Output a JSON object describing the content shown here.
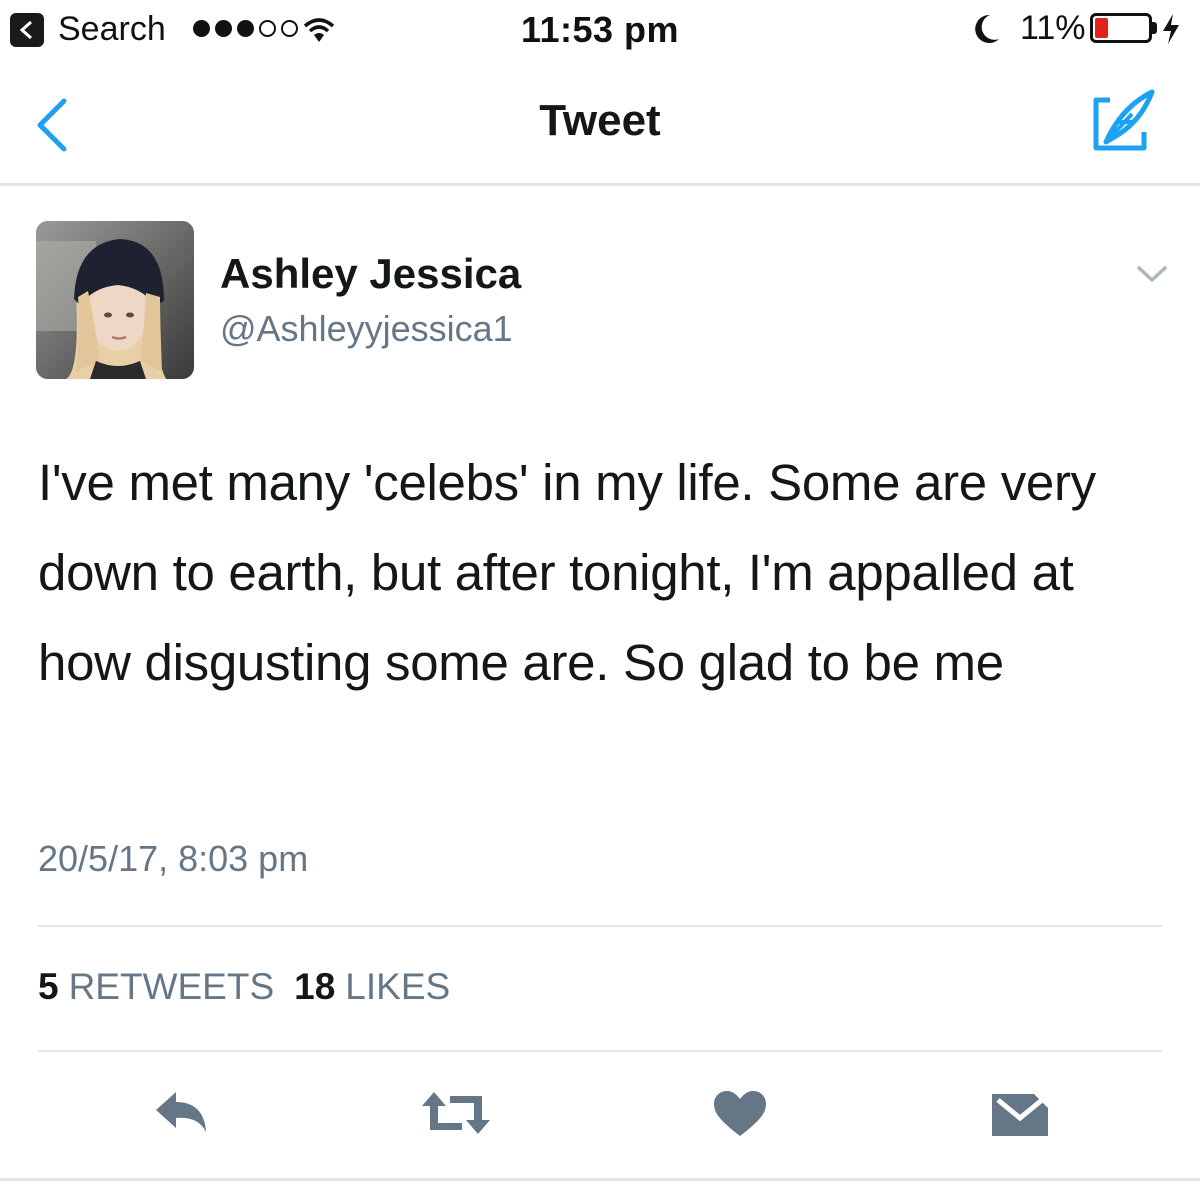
{
  "status_bar": {
    "back_app_label": "Search",
    "time": "11:53 pm",
    "battery_percent": "11%",
    "battery_level": 0.11,
    "signal_bars_filled": 3,
    "signal_bars_total": 5,
    "icons": [
      "back-triangle-icon",
      "signal-dots-icon",
      "wifi-icon",
      "moon-icon",
      "battery-icon",
      "charging-bolt-icon"
    ]
  },
  "nav": {
    "title": "Tweet",
    "icons": [
      "chevron-left-icon",
      "compose-quill-icon"
    ],
    "accent_color": "#1da1f2"
  },
  "tweet": {
    "author_name": "Ashley Jessica",
    "author_handle": "@Ashleyyjessica1",
    "text": "I've met many 'celebs' in my life. Some are very down to earth, but after tonight, I'm appalled at how disgusting some are. So glad to be me",
    "timestamp": "20/5/17, 8:03 pm",
    "retweets_count": "5",
    "retweets_label": "RETWEETS",
    "likes_count": "18",
    "likes_label": "LIKES"
  },
  "actions": {
    "icons": [
      "reply-icon",
      "retweet-icon",
      "like-heart-icon",
      "direct-message-icon"
    ],
    "icon_color": "#657786"
  }
}
